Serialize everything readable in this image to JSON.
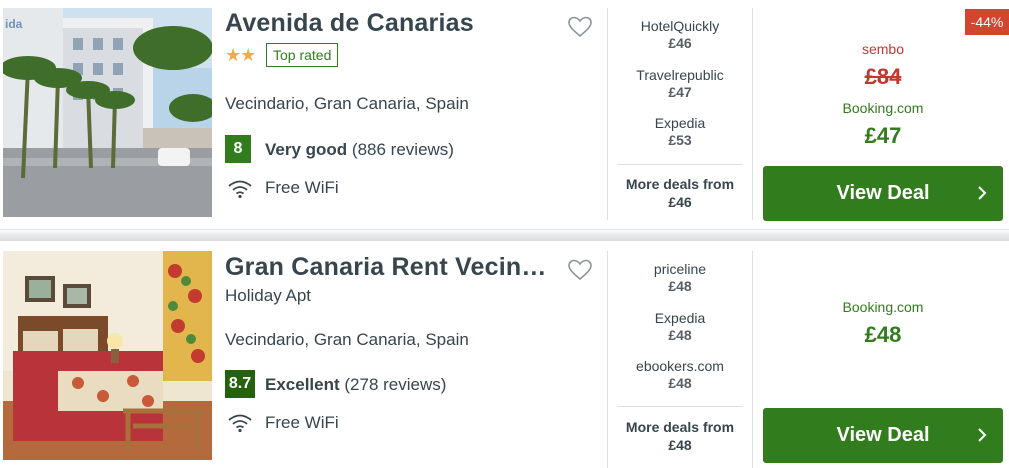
{
  "hotels": [
    {
      "name": "Avenida de Canarias",
      "stars": "★★",
      "badge": "Top rated",
      "location": "Vecindario, Gran Canaria, Spain",
      "rating_score": "8",
      "rating_word": "Very good",
      "reviews": "(886 reviews)",
      "amenity": "Free WiFi",
      "deals": [
        {
          "provider": "HotelQuickly",
          "price": "£46"
        },
        {
          "provider": "Travelrepublic",
          "price": "£47"
        },
        {
          "provider": "Expedia",
          "price": "£53"
        }
      ],
      "more_deals_line1": "More deals from",
      "more_deals_price": "£46",
      "discount": "-44%",
      "original_provider": "sembo",
      "original_price": "£84",
      "best_provider": "Booking.com",
      "best_price": "£47",
      "cta": "View Deal"
    },
    {
      "name": "Gran Canaria Rent Vecindario",
      "subtitle": "Holiday Apt",
      "location": "Vecindario, Gran Canaria, Spain",
      "rating_score": "8.7",
      "rating_word": "Excellent",
      "reviews": "(278 reviews)",
      "amenity": "Free WiFi",
      "deals": [
        {
          "provider": "priceline",
          "price": "£48"
        },
        {
          "provider": "Expedia",
          "price": "£48"
        },
        {
          "provider": "ebookers.com",
          "price": "£48"
        }
      ],
      "more_deals_line1": "More deals from",
      "more_deals_price": "£48",
      "best_provider": "Booking.com",
      "best_price": "£48",
      "cta": "View Deal"
    }
  ],
  "icons": {
    "heart": "heart-outline-icon",
    "wifi": "wifi-icon",
    "chevron": "chevron-right-icon"
  },
  "colors": {
    "accent_green": "#317c1c",
    "rating_dark_green": "#25610f",
    "discount_red": "#d2452e",
    "strike_red": "#c0392b",
    "star_gold": "#f6ab3f"
  }
}
